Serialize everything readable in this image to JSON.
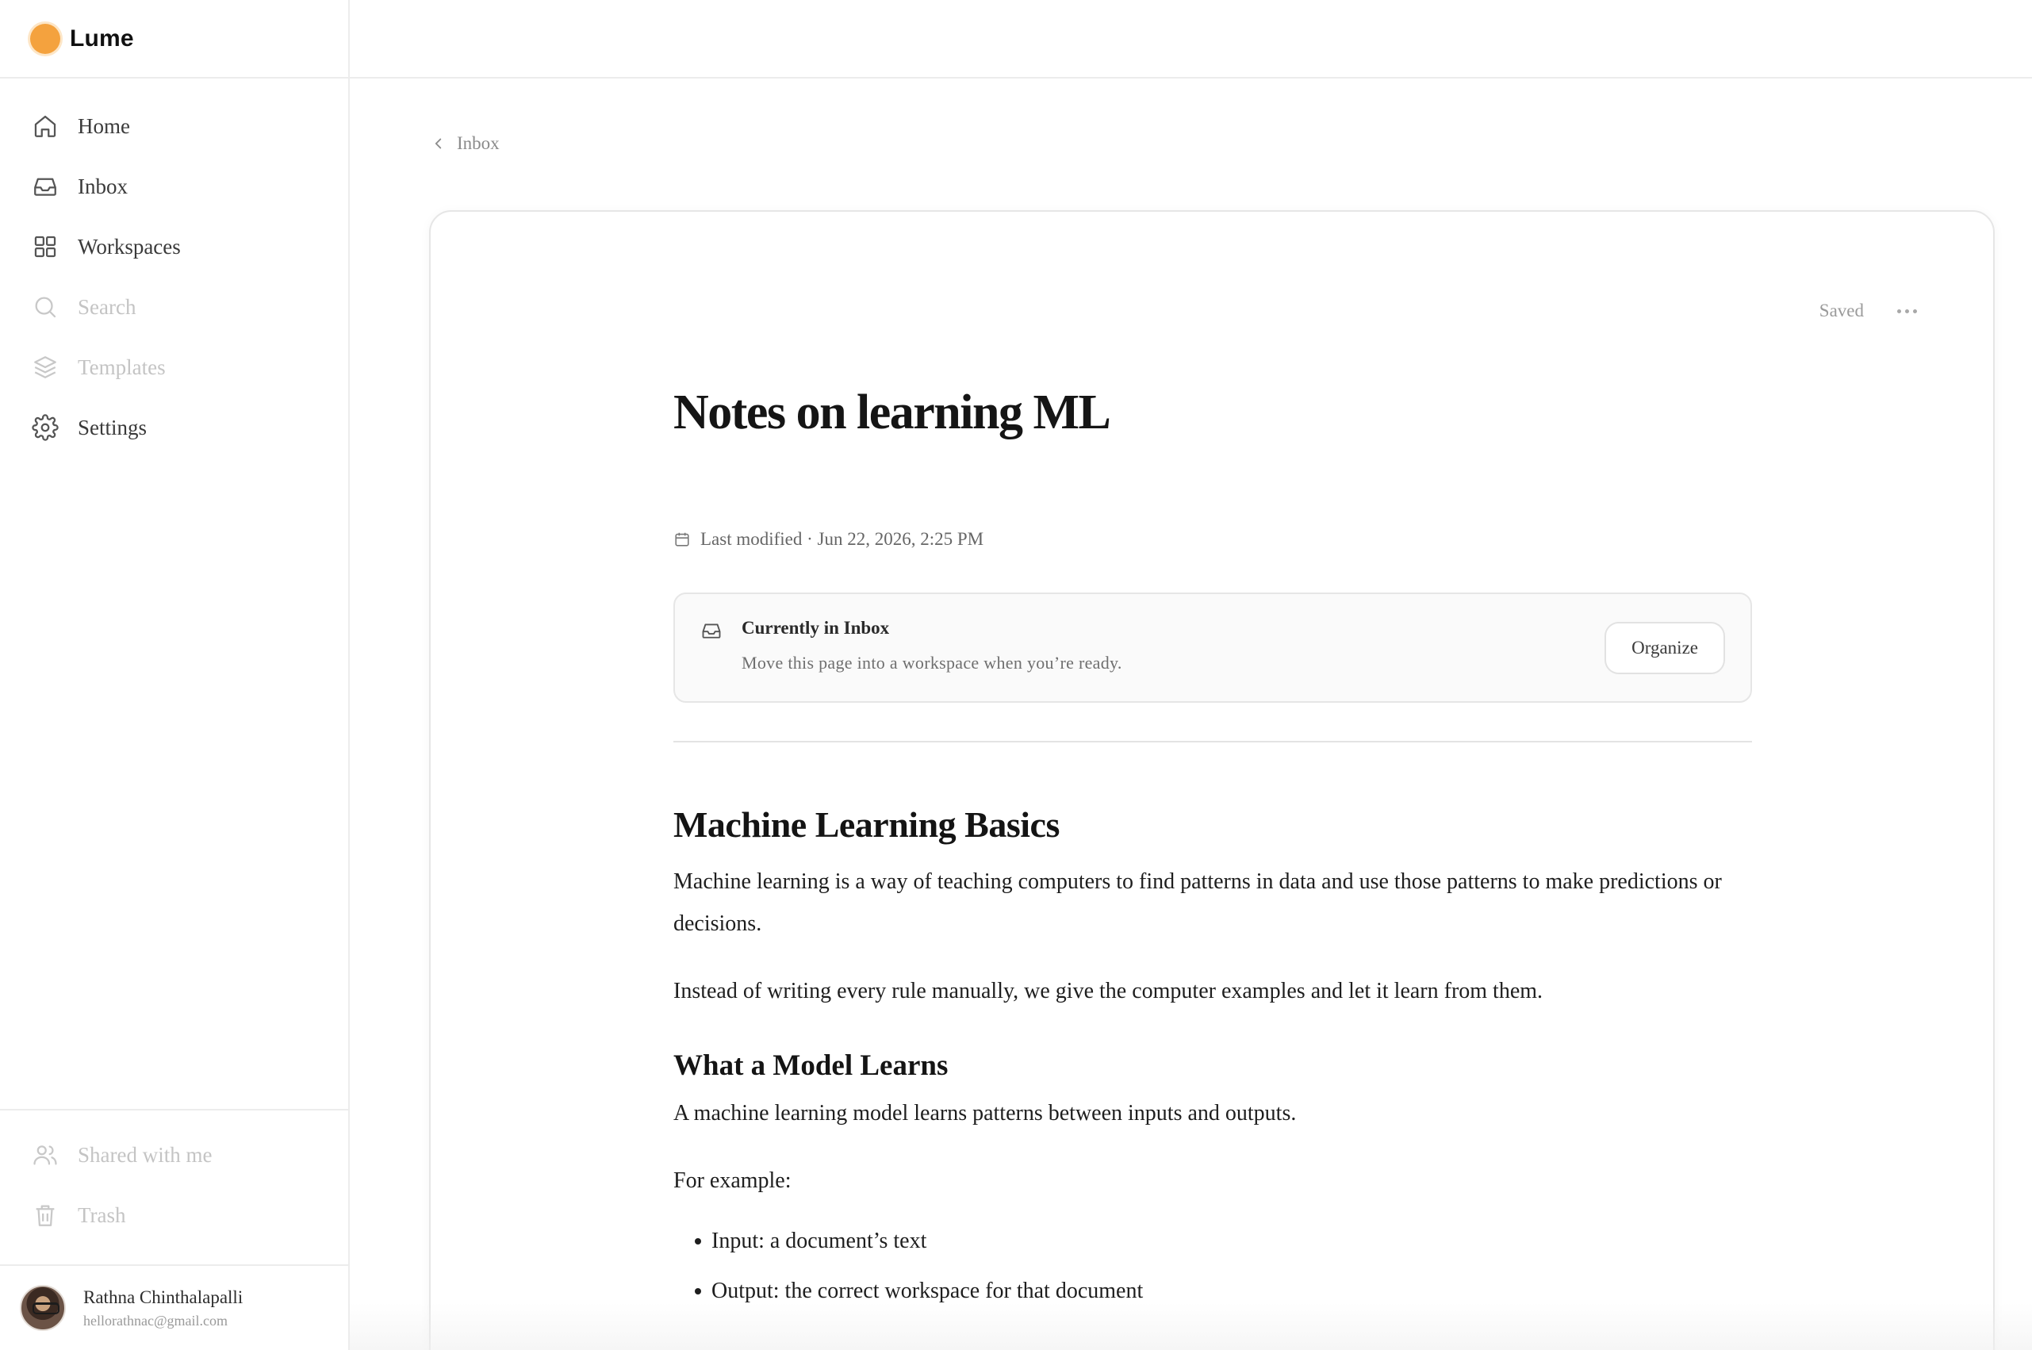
{
  "app": {
    "name": "Lume",
    "accent_color": "#f4a23e"
  },
  "sidebar": {
    "items": [
      {
        "label": "Home",
        "icon": "home-icon",
        "muted": false
      },
      {
        "label": "Inbox",
        "icon": "inbox-icon",
        "muted": false
      },
      {
        "label": "Workspaces",
        "icon": "grid-icon",
        "muted": false
      },
      {
        "label": "Search",
        "icon": "search-icon",
        "muted": true
      },
      {
        "label": "Templates",
        "icon": "layers-icon",
        "muted": true
      },
      {
        "label": "Settings",
        "icon": "gear-icon",
        "muted": false
      }
    ],
    "bottom_items": [
      {
        "label": "Shared with me",
        "icon": "users-icon",
        "muted": true
      },
      {
        "label": "Trash",
        "icon": "trash-icon",
        "muted": true
      }
    ],
    "user": {
      "name": "Rathna Chinthalapalli",
      "email": "hellorathnac@gmail.com"
    }
  },
  "breadcrumb": {
    "label": "Inbox"
  },
  "document": {
    "status": "Saved",
    "title": "Notes on learning ML",
    "meta": "Last modified · Jun 22, 2026, 2:25 PM",
    "notice": {
      "title": "Currently in Inbox",
      "subtitle": "Move this page into a workspace when you’re ready.",
      "button": "Organize"
    },
    "body": {
      "h2": "Machine Learning Basics",
      "p1": "Machine learning is a way of teaching computers to find patterns in data and use those patterns to make predictions or decisions.",
      "p2": "Instead of writing every rule manually, we give the computer examples and let it learn from them.",
      "h3": "What a Model Learns",
      "p3": "A machine learning model learns patterns between inputs and outputs.",
      "p4": "For example:",
      "list": [
        "Input: a document’s text",
        "Output: the correct workspace for that document"
      ]
    }
  }
}
